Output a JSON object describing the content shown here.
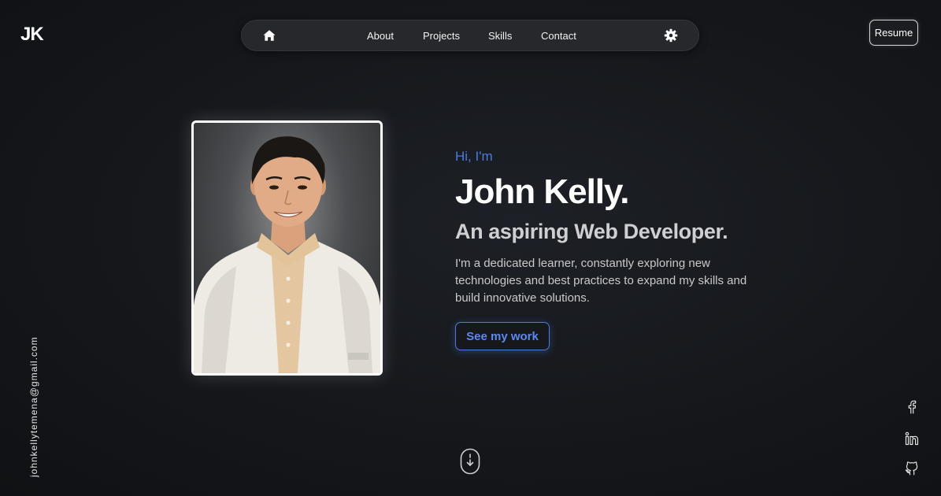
{
  "brand": {
    "logo_text": "JK"
  },
  "nav": {
    "home_icon": "home-icon",
    "links": [
      {
        "label": "About"
      },
      {
        "label": "Projects"
      },
      {
        "label": "Skills"
      },
      {
        "label": "Contact"
      }
    ],
    "settings_icon": "gear-icon"
  },
  "header": {
    "resume_label": "Resume"
  },
  "hero": {
    "greeting": "Hi, I'm",
    "name": "John Kelly.",
    "role": "An aspiring Web Developer.",
    "bio": "I'm a dedicated learner, constantly exploring new technologies and best practices to expand my skills and build innovative solutions.",
    "cta_label": "See my work",
    "photo_icon": "profile-photo"
  },
  "sidebar": {
    "email": "johnkellytemena@gmail.com"
  },
  "social": [
    {
      "icon": "facebook-icon"
    },
    {
      "icon": "linkedin-icon"
    },
    {
      "icon": "github-icon"
    }
  ],
  "scroll_icon": "mouse-scroll-icon",
  "colors": {
    "accent": "#4a7be0",
    "background": "#15171b",
    "navbar": "#26282c"
  }
}
